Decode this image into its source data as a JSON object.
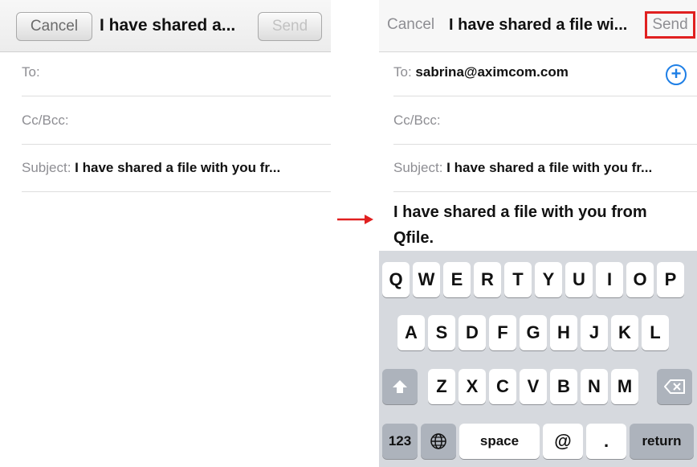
{
  "left": {
    "cancel_label": "Cancel",
    "title": "I have shared a...",
    "send_label": "Send",
    "to_label": "To:",
    "ccbcc_label": "Cc/Bcc:",
    "subject_label": "Subject:",
    "subject_value": "I have shared a file with you fr..."
  },
  "right": {
    "cancel_label": "Cancel",
    "title": "I have shared a file wi...",
    "send_label": "Send",
    "to_label": "To:",
    "to_value": "sabrina@aximcom.com",
    "add_icon": "plus-circle-icon",
    "ccbcc_label": "Cc/Bcc:",
    "subject_label": "Subject:",
    "subject_value": "I have shared a file with you fr...",
    "body": "I have shared a file with you from Qfile."
  },
  "keyboard": {
    "row1": [
      "Q",
      "W",
      "E",
      "R",
      "T",
      "Y",
      "U",
      "I",
      "O",
      "P"
    ],
    "row2": [
      "A",
      "S",
      "D",
      "F",
      "G",
      "H",
      "J",
      "K",
      "L"
    ],
    "row3": [
      "Z",
      "X",
      "C",
      "V",
      "B",
      "N",
      "M"
    ],
    "numbers_label": "123",
    "space_label": "space",
    "at_label": "@",
    "period_label": ".",
    "return_label": "return"
  },
  "colors": {
    "highlight": "#e02020",
    "accent": "#1e7fe6"
  }
}
